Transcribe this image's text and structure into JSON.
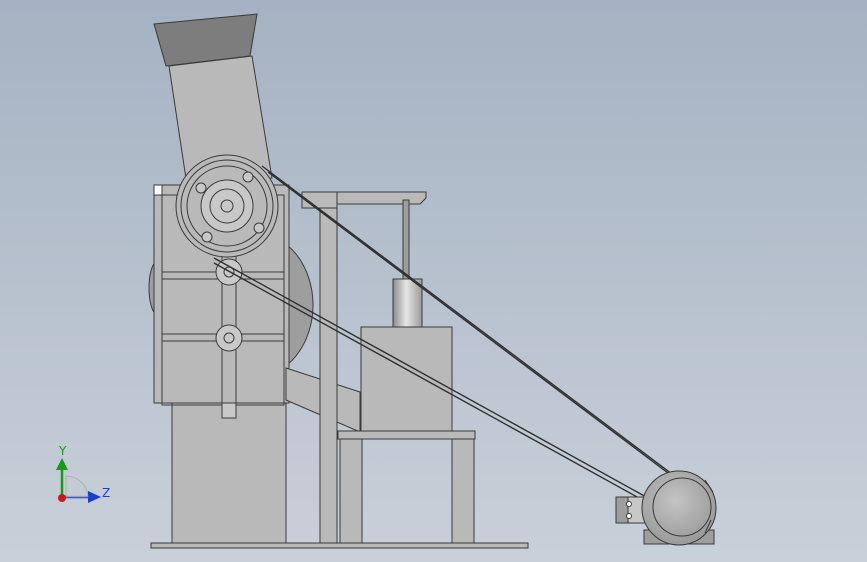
{
  "triad": {
    "y_label": "Y",
    "z_label": "Z",
    "colors": {
      "y_axis": "#1a9a1a",
      "z_axis": "#1a3fc8",
      "origin": "#d01818"
    }
  },
  "colors": {
    "background_top": "#a5b2c3",
    "background_bottom": "#c9d0d9",
    "part_fill": "#b9b9b9",
    "hopper_fill": "#7d7d7d",
    "line": "#3a3a3a"
  }
}
